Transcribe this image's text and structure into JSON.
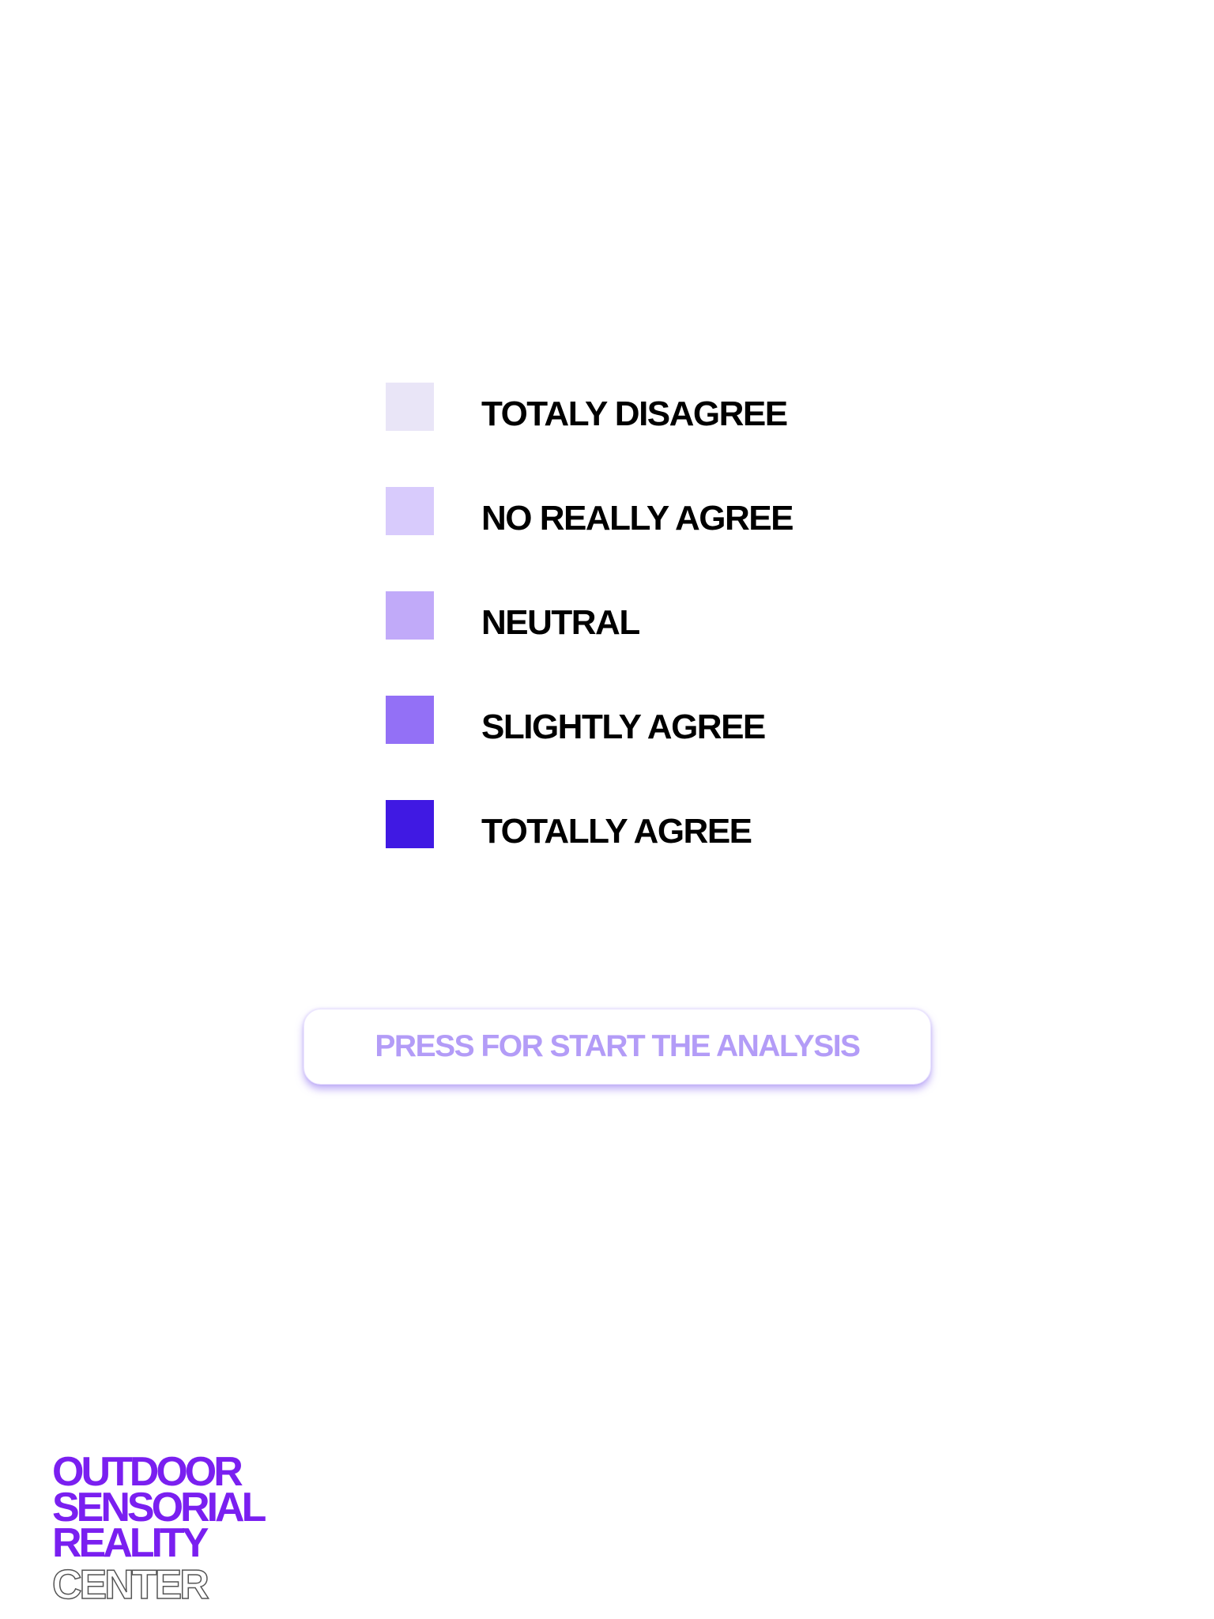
{
  "legend": {
    "items": [
      {
        "label": "TOTALY DISAGREE",
        "color": "#e9e5f7"
      },
      {
        "label": "NO REALLY AGREE",
        "color": "#d8cbfc"
      },
      {
        "label": "NEUTRAL",
        "color": "#c1aaf9"
      },
      {
        "label": "SLIGHTLY AGREE",
        "color": "#9370f6"
      },
      {
        "label": "TOTALLY AGREE",
        "color": "#4019e3"
      }
    ]
  },
  "start_button": {
    "label": "PRESS FOR START THE ANALYSIS",
    "text_color": "#b39cf7"
  },
  "logo": {
    "lines": [
      "OUTDOOR",
      "SENSORIAL",
      "REALITY"
    ],
    "outline_line": "CENTER",
    "color": "#7a1ff0"
  }
}
